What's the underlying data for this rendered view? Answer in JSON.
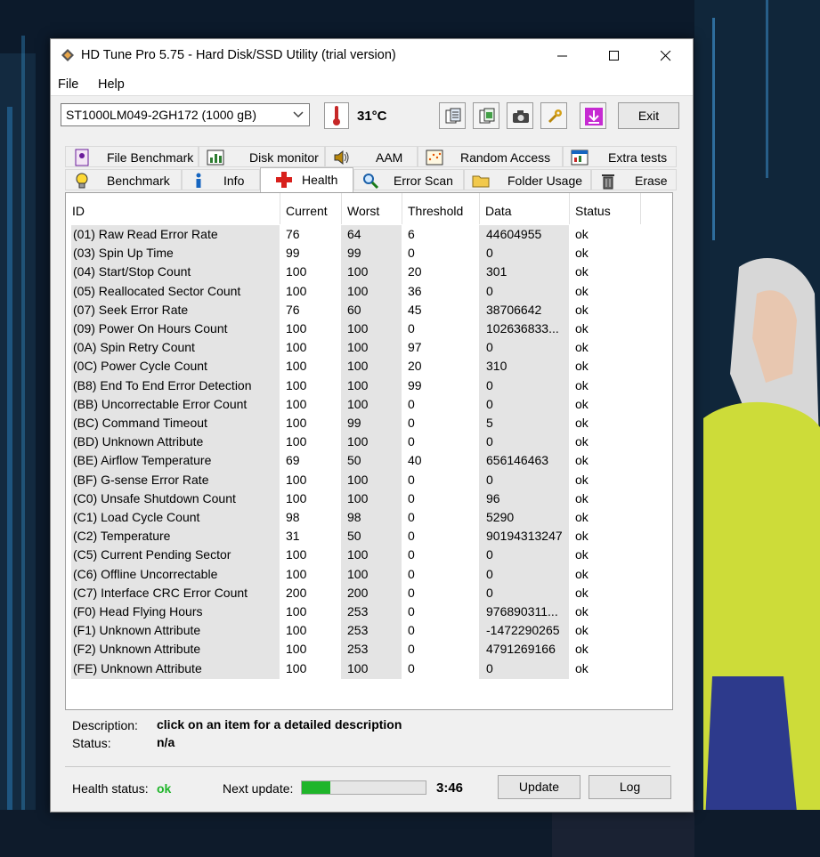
{
  "window": {
    "title": "HD Tune Pro 5.75 - Hard Disk/SSD Utility (trial version)"
  },
  "menu": [
    "File",
    "Help"
  ],
  "toolbar": {
    "drive": "ST1000LM049-2GH172 (1000 gB)",
    "temperature": "31°C",
    "exit_label": "Exit"
  },
  "tabs_top": [
    "File Benchmark",
    "Disk monitor",
    "AAM",
    "Random Access",
    "Extra tests"
  ],
  "tabs_bottom": [
    "Benchmark",
    "Info",
    "Health",
    "Error Scan",
    "Folder Usage",
    "Erase"
  ],
  "active_tab": "Health",
  "table": {
    "columns": [
      "ID",
      "Current",
      "Worst",
      "Threshold",
      "Data",
      "Status"
    ],
    "rows": [
      [
        "(01) Raw Read Error Rate",
        "76",
        "64",
        "6",
        "44604955",
        "ok"
      ],
      [
        "(03) Spin Up Time",
        "99",
        "99",
        "0",
        "0",
        "ok"
      ],
      [
        "(04) Start/Stop Count",
        "100",
        "100",
        "20",
        "301",
        "ok"
      ],
      [
        "(05) Reallocated Sector Count",
        "100",
        "100",
        "36",
        "0",
        "ok"
      ],
      [
        "(07) Seek Error Rate",
        "76",
        "60",
        "45",
        "38706642",
        "ok"
      ],
      [
        "(09) Power On Hours Count",
        "100",
        "100",
        "0",
        "102636833...",
        "ok"
      ],
      [
        "(0A) Spin Retry Count",
        "100",
        "100",
        "97",
        "0",
        "ok"
      ],
      [
        "(0C) Power Cycle Count",
        "100",
        "100",
        "20",
        "310",
        "ok"
      ],
      [
        "(B8) End To End Error Detection",
        "100",
        "100",
        "99",
        "0",
        "ok"
      ],
      [
        "(BB) Uncorrectable Error Count",
        "100",
        "100",
        "0",
        "0",
        "ok"
      ],
      [
        "(BC) Command Timeout",
        "100",
        "99",
        "0",
        "5",
        "ok"
      ],
      [
        "(BD) Unknown Attribute",
        "100",
        "100",
        "0",
        "0",
        "ok"
      ],
      [
        "(BE) Airflow Temperature",
        "69",
        "50",
        "40",
        "656146463",
        "ok"
      ],
      [
        "(BF) G-sense Error Rate",
        "100",
        "100",
        "0",
        "0",
        "ok"
      ],
      [
        "(C0) Unsafe Shutdown Count",
        "100",
        "100",
        "0",
        "96",
        "ok"
      ],
      [
        "(C1) Load Cycle Count",
        "98",
        "98",
        "0",
        "5290",
        "ok"
      ],
      [
        "(C2) Temperature",
        "31",
        "50",
        "0",
        "90194313247",
        "ok"
      ],
      [
        "(C5) Current Pending Sector",
        "100",
        "100",
        "0",
        "0",
        "ok"
      ],
      [
        "(C6) Offline Uncorrectable",
        "100",
        "100",
        "0",
        "0",
        "ok"
      ],
      [
        "(C7) Interface CRC Error Count",
        "200",
        "200",
        "0",
        "0",
        "ok"
      ],
      [
        "(F0) Head Flying Hours",
        "100",
        "253",
        "0",
        "976890311...",
        "ok"
      ],
      [
        "(F1) Unknown Attribute",
        "100",
        "253",
        "0",
        "-1472290265",
        "ok"
      ],
      [
        "(F2) Unknown Attribute",
        "100",
        "253",
        "0",
        "4791269166",
        "ok"
      ],
      [
        "(FE) Unknown Attribute",
        "100",
        "100",
        "0",
        "0",
        "ok"
      ]
    ]
  },
  "description": {
    "label": "Description:",
    "value": "click on an item for a detailed description",
    "status_label": "Status:",
    "status_value": "n/a"
  },
  "footer": {
    "health_label": "Health status:",
    "health_value": "ok",
    "next_update_label": "Next update:",
    "progress_fraction": 0.23,
    "countdown": "3:46",
    "update_label": "Update",
    "log_label": "Log"
  },
  "colors": {
    "ok_green": "#1fb52a",
    "active_tab_icon": "#d8201c"
  }
}
